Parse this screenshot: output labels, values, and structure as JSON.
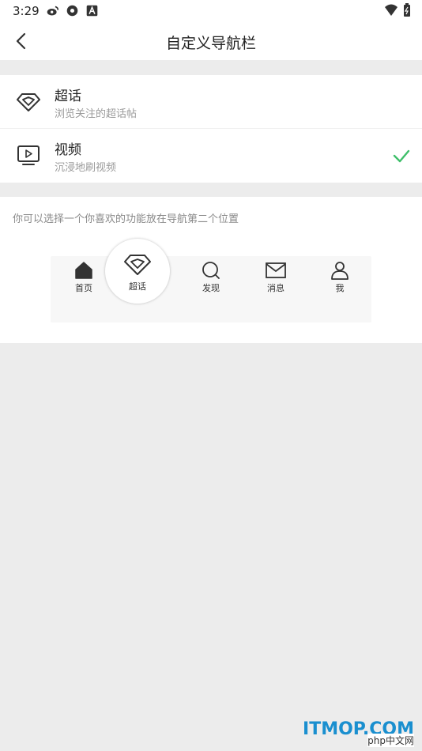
{
  "status_bar": {
    "time": "3:29"
  },
  "nav": {
    "title": "自定义导航栏"
  },
  "options": [
    {
      "title": "超话",
      "subtitle": "浏览关注的超话帖",
      "icon": "diamond-icon",
      "selected": false
    },
    {
      "title": "视频",
      "subtitle": "沉浸地刷视频",
      "icon": "video-icon",
      "selected": true
    }
  ],
  "preview": {
    "hint": "你可以选择一个你喜欢的功能放在导航第二个位置",
    "tabs": [
      {
        "label": "首页",
        "icon": "home-icon"
      },
      {
        "label": "超话",
        "icon": "diamond-icon"
      },
      {
        "label": "发现",
        "icon": "search-icon"
      },
      {
        "label": "消息",
        "icon": "mail-icon"
      },
      {
        "label": "我",
        "icon": "person-icon"
      }
    ]
  },
  "watermark": {
    "main": "ITMOP.COM",
    "sub": "php中文网"
  },
  "colors": {
    "accent_check": "#3fbf6a",
    "background": "#ececec"
  }
}
